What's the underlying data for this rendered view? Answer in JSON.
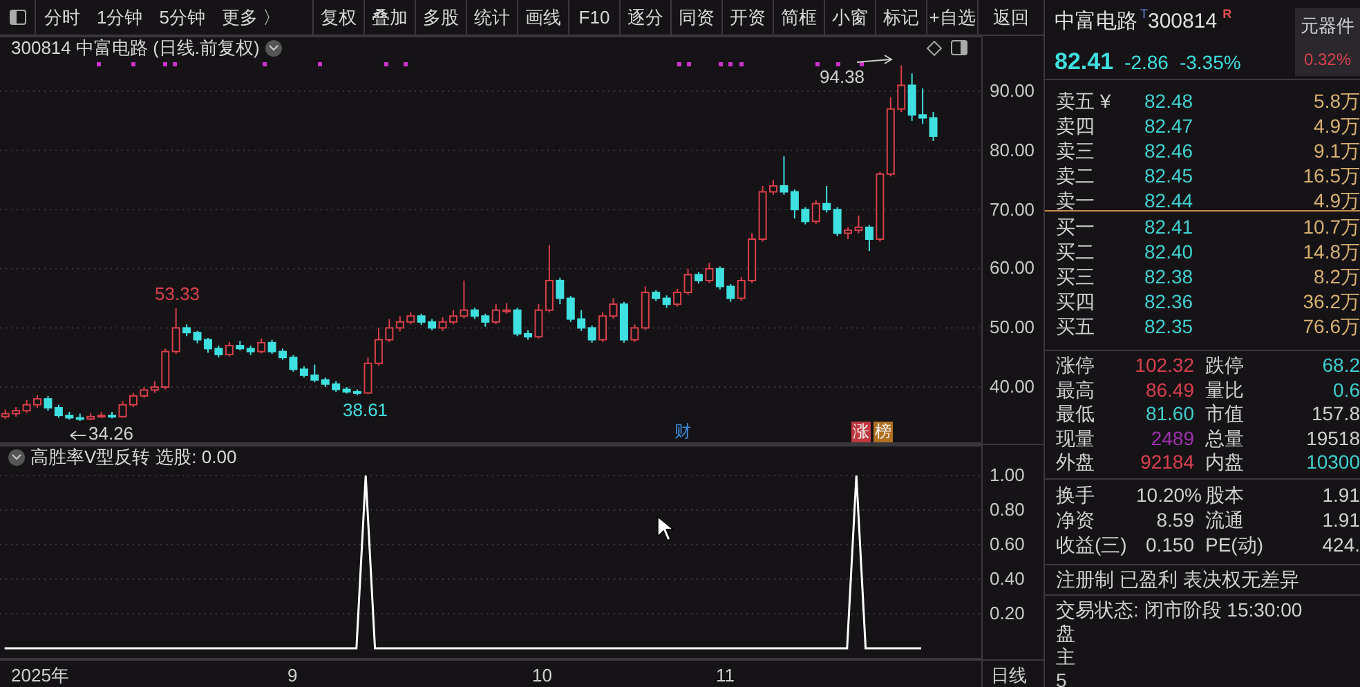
{
  "toolbar": {
    "periods": [
      "分时",
      "1分钟",
      "5分钟",
      "更多 〉"
    ],
    "buttons": [
      "复权",
      "叠加",
      "多股",
      "统计",
      "画线",
      "F10",
      "逐分",
      "同资",
      "开资",
      "简框",
      "小窗",
      "标记",
      "+自选"
    ],
    "back": "返回"
  },
  "chart": {
    "title": "300814 中富电路 (日线.前复权)",
    "annotations": [
      {
        "kind": "high",
        "text": "94.38"
      },
      {
        "kind": "local_high",
        "text": "53.33"
      },
      {
        "kind": "local_low",
        "text": "38.61"
      },
      {
        "kind": "low",
        "text": "34.26"
      }
    ],
    "event_tags": [
      {
        "text": "财",
        "kind": "plain",
        "color": "#3d8fe0"
      },
      {
        "text": "涨",
        "kind": "filled",
        "color": "#c03840"
      },
      {
        "text": "榜",
        "kind": "filled",
        "color": "#b07020"
      }
    ],
    "chart_data": {
      "type": "candlestick",
      "grid": true,
      "ylim": [
        30.42,
        99.35
      ],
      "yticks": [
        {
          "value": 90,
          "label": "90.00"
        },
        {
          "value": 80,
          "label": "80.00"
        },
        {
          "value": 70,
          "label": "70.00"
        },
        {
          "value": 60,
          "label": "60.00"
        },
        {
          "value": 50,
          "label": "50.00"
        },
        {
          "value": 40,
          "label": "40.00"
        }
      ],
      "categories": [
        null,
        null,
        null,
        null,
        null,
        null,
        null,
        null,
        null,
        null,
        null,
        null,
        null,
        null,
        null,
        null,
        null,
        null,
        null,
        null,
        null,
        null,
        null,
        null,
        null,
        null,
        null,
        null,
        null,
        null,
        null,
        null,
        null,
        null,
        null,
        null,
        null,
        null,
        null,
        null,
        null,
        null,
        null,
        null,
        null,
        null,
        null,
        null,
        null,
        null,
        null,
        null,
        null,
        null,
        null,
        null,
        null,
        null,
        null,
        null,
        null,
        null,
        null,
        null,
        null,
        null,
        null,
        null,
        null,
        null,
        null,
        null,
        null,
        null,
        null,
        null,
        null,
        null,
        null,
        null,
        null,
        null,
        null,
        null,
        null,
        null,
        null,
        null,
        null,
        null,
        null,
        null
      ],
      "ohlc": [
        [
          35,
          36.2,
          34.6,
          35.5
        ],
        [
          35.5,
          36.6,
          35,
          36
        ],
        [
          36,
          37.8,
          35.6,
          37
        ],
        [
          37,
          38.6,
          36.5,
          38
        ],
        [
          38,
          38.5,
          36,
          36.5
        ],
        [
          36.5,
          37,
          34.8,
          35.2
        ],
        [
          35.2,
          35.8,
          34.5,
          34.8
        ],
        [
          34.8,
          35.5,
          34.26,
          34.6
        ],
        [
          34.6,
          35.6,
          34.4,
          35
        ],
        [
          35,
          35.8,
          34.8,
          35.2
        ],
        [
          35.2,
          35.8,
          34.7,
          35
        ],
        [
          35,
          37.6,
          34.8,
          37
        ],
        [
          37,
          39,
          36.6,
          38.5
        ],
        [
          38.5,
          40,
          38.2,
          39.5
        ],
        [
          39.5,
          41,
          39,
          40
        ],
        [
          40,
          46.5,
          39.6,
          46
        ],
        [
          46,
          53.33,
          45.6,
          50
        ],
        [
          50,
          50.6,
          48.6,
          49.2
        ],
        [
          49.2,
          49.5,
          47.4,
          48
        ],
        [
          48,
          48.3,
          45.8,
          46.5
        ],
        [
          46.5,
          47,
          45,
          45.5
        ],
        [
          45.5,
          47.6,
          45.2,
          47
        ],
        [
          47,
          47.8,
          46.2,
          46.5
        ],
        [
          46.5,
          47,
          45.4,
          46
        ],
        [
          46,
          48.2,
          45.7,
          47.5
        ],
        [
          47.5,
          48,
          45.6,
          46
        ],
        [
          46,
          46.5,
          44.6,
          45
        ],
        [
          45,
          45.4,
          42.6,
          43
        ],
        [
          43,
          43.5,
          41.6,
          42
        ],
        [
          42,
          43.8,
          40.8,
          41.2
        ],
        [
          41.2,
          41.6,
          40,
          40.5
        ],
        [
          40.5,
          41,
          39.2,
          39.6
        ],
        [
          39.6,
          40,
          38.9,
          39.2
        ],
        [
          39.2,
          39.6,
          38.61,
          39
        ],
        [
          39,
          45,
          38.8,
          44
        ],
        [
          44,
          50,
          43.6,
          48
        ],
        [
          48,
          51.5,
          47.6,
          50
        ],
        [
          50,
          52,
          49.4,
          51
        ],
        [
          51,
          52.6,
          50.6,
          52
        ],
        [
          52,
          52.4,
          50.5,
          51
        ],
        [
          51,
          51.5,
          49.6,
          50
        ],
        [
          50,
          51.8,
          49.5,
          51
        ],
        [
          51,
          53,
          50.6,
          52
        ],
        [
          52,
          58,
          51.6,
          53
        ],
        [
          53,
          53.4,
          51.5,
          52
        ],
        [
          52,
          52.4,
          50.2,
          51
        ],
        [
          51,
          54,
          50.6,
          53
        ],
        [
          53,
          54.2,
          52.4,
          53
        ],
        [
          53,
          53.4,
          48.6,
          49
        ],
        [
          49,
          49.6,
          48,
          48.5
        ],
        [
          48.5,
          54,
          48.2,
          53
        ],
        [
          53,
          64,
          52.6,
          58
        ],
        [
          58,
          58.5,
          54,
          55
        ],
        [
          55,
          55.4,
          51,
          51.5
        ],
        [
          51.5,
          53,
          49.5,
          50
        ],
        [
          50,
          50.4,
          47.5,
          48
        ],
        [
          48,
          52.6,
          47.6,
          52
        ],
        [
          52,
          55,
          51.6,
          54
        ],
        [
          54,
          54.4,
          47.5,
          48
        ],
        [
          48,
          50.6,
          47.6,
          50
        ],
        [
          50,
          57,
          49.6,
          56
        ],
        [
          56,
          56.4,
          54.5,
          55
        ],
        [
          55,
          55.5,
          53.4,
          54
        ],
        [
          54,
          56.6,
          53.6,
          56
        ],
        [
          56,
          60,
          55.6,
          59
        ],
        [
          59,
          59.4,
          57.5,
          58
        ],
        [
          58,
          61,
          57.6,
          60
        ],
        [
          60,
          60.4,
          56.5,
          57
        ],
        [
          57,
          57.4,
          54.4,
          55
        ],
        [
          55,
          58.6,
          54.6,
          58
        ],
        [
          58,
          66,
          57.6,
          65
        ],
        [
          65,
          74,
          64.6,
          73
        ],
        [
          73,
          75,
          72.5,
          74
        ],
        [
          74,
          79,
          72.5,
          73
        ],
        [
          73,
          73.4,
          68.5,
          70
        ],
        [
          70,
          70.4,
          67.5,
          68
        ],
        [
          68,
          71.6,
          67.6,
          71
        ],
        [
          71,
          74,
          69.5,
          70
        ],
        [
          70,
          70.4,
          65.5,
          66
        ],
        [
          66,
          67,
          65,
          66.5
        ],
        [
          66.5,
          69,
          66,
          67
        ],
        [
          67,
          67.4,
          63,
          65
        ],
        [
          65,
          76.4,
          64.6,
          76
        ],
        [
          76,
          89,
          75.6,
          87
        ],
        [
          87,
          94.38,
          86.5,
          91
        ],
        [
          91,
          93,
          85,
          86
        ],
        [
          86,
          90.5,
          84.5,
          85.5
        ],
        [
          85.5,
          86.49,
          81.6,
          82.41
        ],
        null,
        null,
        null,
        null
      ]
    }
  },
  "indicator": {
    "title": "选股: 0.00",
    "chart_data": {
      "type": "line",
      "grid": true,
      "categories": [
        null,
        null,
        null,
        null,
        null,
        null,
        null,
        null,
        null,
        null,
        null,
        null,
        null,
        null,
        null,
        null,
        null,
        null,
        null,
        null,
        null,
        null,
        null,
        null,
        null,
        null,
        null,
        null,
        null,
        null,
        null,
        null,
        null,
        null,
        null,
        null,
        null,
        null,
        null,
        null,
        null,
        null,
        null,
        null,
        null,
        null,
        null,
        null,
        null,
        null,
        null,
        null,
        null,
        null,
        null,
        null,
        null,
        null,
        null,
        null,
        null,
        null,
        null,
        null,
        null,
        null,
        null,
        null,
        null,
        null,
        null,
        null,
        null,
        null,
        null,
        null,
        null,
        null,
        null,
        null,
        null,
        null,
        null,
        null,
        null,
        null,
        null,
        null,
        null,
        null,
        null,
        null,
        null,
        null,
        null,
        null,
        null,
        null,
        null,
        null,
        null,
        null,
        null,
        null,
        null,
        null
      ],
      "series": [
        {
          "name": "高胜率V型反转",
          "color": "#ffffff",
          "values": [
            0,
            0,
            0,
            0,
            0,
            0,
            0,
            0,
            0,
            0,
            0,
            0,
            0,
            0,
            0,
            0,
            0,
            0,
            0,
            0,
            0,
            0,
            0,
            0,
            0,
            0,
            0,
            0,
            0,
            0,
            0,
            0,
            0,
            0,
            0,
            0,
            0,
            0,
            0,
            1,
            0,
            0,
            0,
            0,
            0,
            0,
            0,
            0,
            0,
            0,
            0,
            0,
            0,
            0,
            0,
            0,
            0,
            0,
            0,
            0,
            0,
            0,
            0,
            0,
            0,
            0,
            0,
            0,
            0,
            0,
            0,
            0,
            0,
            0,
            0,
            0,
            0,
            0,
            0,
            0,
            0,
            0,
            0,
            0,
            0,
            0,
            0,
            0,
            0,
            0,
            0,
            0,
            1,
            0,
            0,
            0,
            0,
            0,
            0,
            0,
            null,
            null,
            null,
            null,
            null,
            null
          ]
        }
      ],
      "ylim": [
        -0.064,
        1.176
      ],
      "yticks": [
        {
          "value": 1,
          "label": "1.00"
        },
        {
          "value": 0.8,
          "label": "0.80"
        },
        {
          "value": 0.6,
          "label": "0.60"
        },
        {
          "value": 0.4,
          "label": "0.40"
        },
        {
          "value": 0.2,
          "label": "0.20"
        }
      ]
    }
  },
  "time_axis": {
    "labels": [
      "2025年",
      "9",
      "10",
      "11"
    ],
    "period": "日线"
  },
  "quote": {
    "name": "中富电路",
    "mark": "T",
    "code": "300814",
    "flag": "R",
    "sector": "元器件",
    "sector_change": "0.32%",
    "price": "82.41",
    "change": "-2.86",
    "change_pct": "-3.35%",
    "asks": [
      {
        "label": "卖五 ¥",
        "price": "82.48",
        "volume": "5.8万"
      },
      {
        "label": "卖四",
        "price": "82.47",
        "volume": "4.9万"
      },
      {
        "label": "卖三",
        "price": "82.46",
        "volume": "9.1万"
      },
      {
        "label": "卖二",
        "price": "82.45",
        "volume": "16.5万"
      },
      {
        "label": "卖一",
        "price": "82.44",
        "volume": "4.9万"
      }
    ],
    "bids": [
      {
        "label": "买一",
        "price": "82.41",
        "volume": "10.7万"
      },
      {
        "label": "买二",
        "price": "82.40",
        "volume": "14.8万"
      },
      {
        "label": "买三",
        "price": "82.38",
        "volume": "8.2万"
      },
      {
        "label": "买四",
        "price": "82.36",
        "volume": "36.2万"
      },
      {
        "label": "买五",
        "price": "82.35",
        "volume": "76.6万"
      }
    ],
    "stats": [
      {
        "label": "涨停",
        "value": "102.32",
        "color": "#d94050"
      },
      {
        "label": "跌停",
        "value": "68.2",
        "color": "#40d0d0"
      },
      {
        "label": "最高",
        "value": "86.49",
        "color": "#d94050"
      },
      {
        "label": "量比",
        "value": "0.6",
        "color": "#40d0d0"
      },
      {
        "label": "最低",
        "value": "81.60",
        "color": "#40d0d0"
      },
      {
        "label": "市值",
        "value": "157.8",
        "color": "#d0d0d0"
      },
      {
        "label": "现量",
        "value": "2489",
        "color": "#a030b0"
      },
      {
        "label": "总量",
        "value": "19518",
        "color": "#d0d0d0"
      },
      {
        "label": "外盘",
        "value": "92184",
        "color": "#d94050"
      },
      {
        "label": "内盘",
        "value": "10300",
        "color": "#40d0d0"
      }
    ],
    "fundamentals": [
      {
        "label": "换手",
        "value": "10.20%"
      },
      {
        "label": "股本",
        "value": "1.91"
      },
      {
        "label": "净资",
        "value": "8.59"
      },
      {
        "label": "流通",
        "value": "1.91"
      },
      {
        "label": "收益(三)",
        "value": "0.150"
      },
      {
        "label": "PE(动)",
        "value": "424."
      }
    ],
    "tags": "注册制 已盈利 表决权无差异",
    "status": "交易状态: 闭市阶段 15:30:00",
    "cut_rows": [
      "盘",
      "主",
      "5"
    ]
  }
}
